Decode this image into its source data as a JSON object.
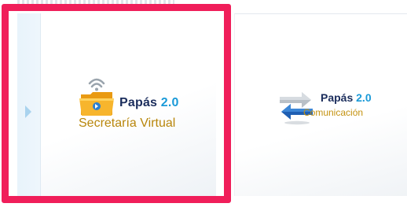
{
  "cards": [
    {
      "brand_name": "Papás",
      "brand_version": "2.0",
      "subtitle": "Secretaría Virtual",
      "selected": true
    },
    {
      "brand_name": "Papás",
      "brand_version": "2.0",
      "subtitle": "Comunicación",
      "selected": false
    }
  ],
  "icons": {
    "card1": "folder-wifi-icon",
    "card2": "exchange-arrows-icon",
    "handle": "chevron-right-icon"
  },
  "colors": {
    "highlight": "#f01e5a",
    "brand_navy": "#1b2d5c",
    "brand_blue": "#1a9ad8",
    "subtitle_gold": "#b8860b"
  }
}
